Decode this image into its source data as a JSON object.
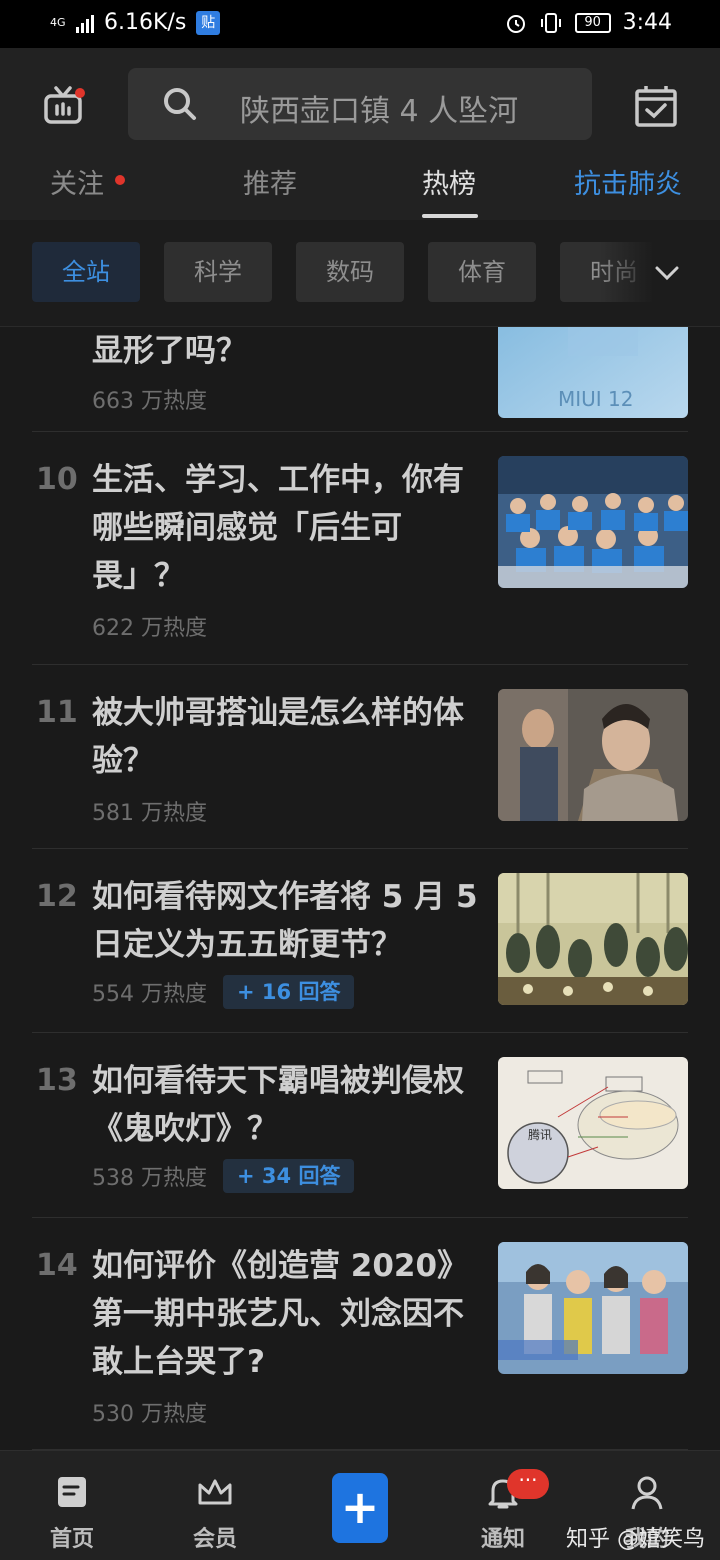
{
  "status_bar": {
    "network": "4G",
    "speed": "6.16K/s",
    "app_badge": "贴",
    "battery": "90",
    "time": "3:44"
  },
  "header": {
    "search_placeholder": "陕西壶口镇 4 人坠河",
    "tabs": [
      "关注",
      "推荐",
      "热榜",
      "抗击肺炎"
    ]
  },
  "categories": [
    "全站",
    "科学",
    "数码",
    "体育",
    "时尚"
  ],
  "list": [
    {
      "rank": "",
      "title": "显形了吗？",
      "heat": "663 万热度",
      "answers": "",
      "thumb_text": "MIUI 12"
    },
    {
      "rank": "10",
      "title": "生活、学习、工作中，你有哪些瞬间感觉「后生可畏」？",
      "heat": "622 万热度",
      "answers": "",
      "thumb_text": ""
    },
    {
      "rank": "11",
      "title": "被大帅哥搭讪是怎么样的体验？",
      "heat": "581 万热度",
      "answers": "",
      "thumb_text": ""
    },
    {
      "rank": "12",
      "title": "如何看待网文作者将 5 月 5 日定义为五五断更节？",
      "heat": "554 万热度",
      "answers": "+ 16 回答",
      "thumb_text": ""
    },
    {
      "rank": "13",
      "title": "如何看待天下霸唱被判侵权《鬼吹灯》？",
      "heat": "538 万热度",
      "answers": "+ 34 回答",
      "thumb_text": "腾讯"
    },
    {
      "rank": "14",
      "title": "如何评价《创造营 2020》第一期中张艺凡、刘念因不敢上台哭了?",
      "heat": "530 万热度",
      "answers": "",
      "thumb_text": ""
    }
  ],
  "bottom_nav": {
    "home": "首页",
    "vip": "会员",
    "plus": "+",
    "notify": "通知",
    "notify_badge": "···",
    "me": "我的",
    "watermark": "知乎 @嬉笑鸟"
  },
  "colors": {
    "accent": "#3d8fe0",
    "badge": "#e0352b",
    "background": "#1a1a1a"
  }
}
